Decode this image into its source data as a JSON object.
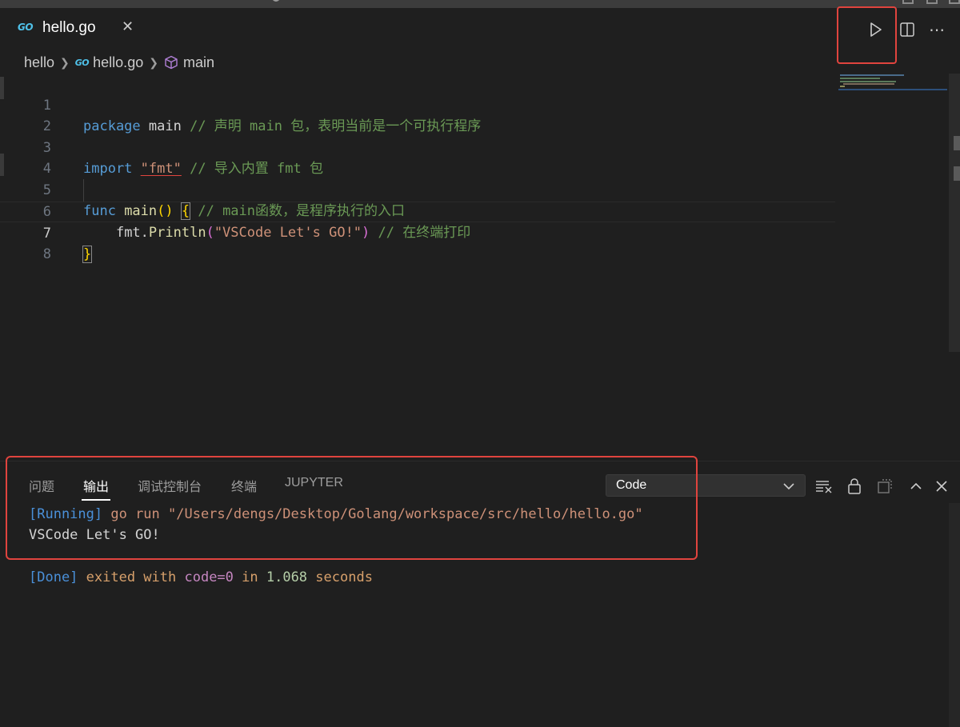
{
  "tab": {
    "logo": "GO",
    "title": "hello.go",
    "close": "✕"
  },
  "toolbar": {
    "run": "run-icon",
    "split": "split-editor-icon",
    "more": "⋯"
  },
  "breadcrumb": {
    "folder": "hello",
    "logo": "GO",
    "file": "hello.go",
    "symbol": "main"
  },
  "editor": {
    "line_numbers": [
      "1",
      "2",
      "3",
      "4",
      "5",
      "6",
      "7",
      "8"
    ],
    "active_line": "7",
    "lines": [
      {
        "kw": "package",
        "rest": " main",
        "cmt": " // 声明 main 包，表明当前是一个可执行程序"
      },
      {
        "text": ""
      },
      {
        "kw": "import",
        "pre": " ",
        "str": "\"fmt\"",
        "cmt": " // 导入内置 fmt 包"
      },
      {
        "text": ""
      },
      {
        "kw": "func",
        "fn": " main",
        "paren": "()",
        "brace": "{",
        "cmt": " // main函数，是程序执行的入口"
      },
      {
        "indent": "    ",
        "obj": "fmt.",
        "fn": "Println",
        "open": "(",
        "str": "\"VSCode Let's GO!\"",
        "close": ")",
        "cmt": " // 在终端打印"
      },
      {
        "brace": "}"
      },
      {
        "text": ""
      }
    ]
  },
  "panel": {
    "tabs": [
      "问题",
      "输出",
      "调试控制台",
      "终端",
      "JUPYTER"
    ],
    "active_tab": "输出",
    "channel": "Code",
    "output": {
      "running_tag": "[Running]",
      "command": " go run \"/Users/dengs/Desktop/Golang/workspace/src/hello/hello.go\"",
      "program_output": "VSCode Let's GO!",
      "done_tag": "[Done]",
      "exited": " exited with ",
      "code": "code=0",
      "in": " in ",
      "seconds_value": "1.068",
      "seconds": " seconds"
    }
  },
  "colors": {
    "accent_highlight": "#e0443e",
    "keyword": "#569cd6",
    "string": "#ce9178",
    "comment": "#6a9955",
    "function": "#dcdcaa"
  }
}
